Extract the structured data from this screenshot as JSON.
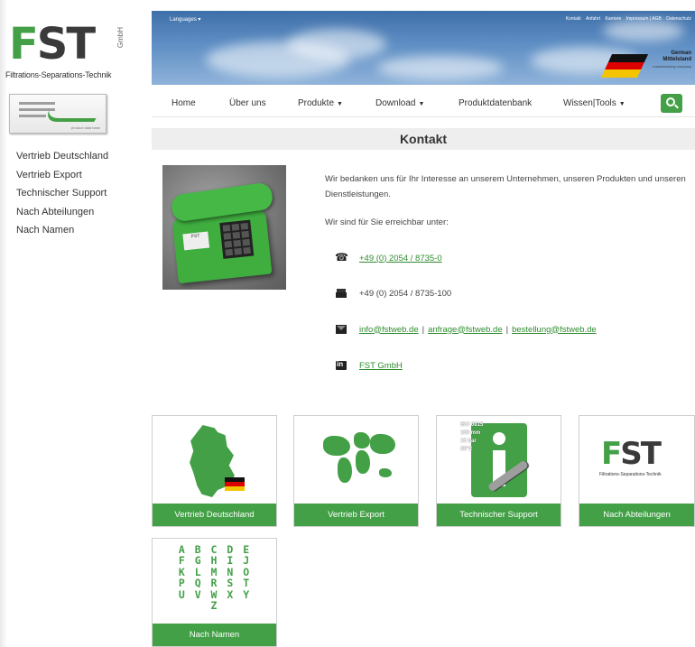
{
  "logo": {
    "brand": "FST",
    "gmbh": "GmbH",
    "tagline": "Filtrations-Separations-Technik"
  },
  "product_db_button": {
    "text": "product data base"
  },
  "sidebar": {
    "items": [
      {
        "label": "Vertrieb Deutschland"
      },
      {
        "label": "Vertrieb Export"
      },
      {
        "label": "Technischer Support"
      },
      {
        "label": "Nach Abteilungen"
      },
      {
        "label": "Nach Namen"
      }
    ]
  },
  "header": {
    "languages": "Languages ▾",
    "top_links": [
      "Kontakt",
      "Anfahrt",
      "Karriere",
      "Impressum | AGB",
      "Datenschutz"
    ],
    "badge": {
      "line1": "German",
      "line2": "Mittelstand",
      "line3": "manufacturing company"
    }
  },
  "nav": {
    "items": [
      {
        "label": "Home",
        "caret": ""
      },
      {
        "label": "Über uns",
        "caret": ""
      },
      {
        "label": "Produkte",
        "caret": "▼"
      },
      {
        "label": "Download",
        "caret": "▼"
      },
      {
        "label": "Produktdatenbank",
        "caret": ""
      },
      {
        "label": "Wissen|Tools",
        "caret": "▼"
      }
    ],
    "search_icon": "search-icon"
  },
  "page_title": "Kontakt",
  "contact": {
    "intro": "Wir bedanken uns für Ihr Interesse an unserem Unternehmen, unseren Produkten und unseren Dienstleistungen.",
    "available": "Wir sind für Sie erreichbar unter:",
    "phone": "+49 (0) 2054 / 8735-0",
    "fax": "+49 (0) 2054 / 8735-100",
    "emails": [
      "info@fstweb.de",
      "anfrage@fstweb.de",
      "bestellung@fstweb.de"
    ],
    "email_separator": "|",
    "linkedin": "FST GmbH"
  },
  "tiles": [
    {
      "caption": "Vertrieb Deutschland"
    },
    {
      "caption": "Vertrieb Export"
    },
    {
      "caption": "Technischer Support"
    },
    {
      "caption": "Nach Abteilungen"
    },
    {
      "caption": "Nach Namen"
    }
  ],
  "tile_images": {
    "iso": [
      "ISO 0815",
      "100 mm",
      "16 bar",
      "35°C"
    ],
    "alphabet": "A B C D E\nF G H I J\nK L M N O\nP Q R S T\nU V W X Y\nZ",
    "phone_label": "FST"
  },
  "colors": {
    "accent": "#43a047",
    "title_bg": "#eeeeee",
    "text": "#333333"
  }
}
